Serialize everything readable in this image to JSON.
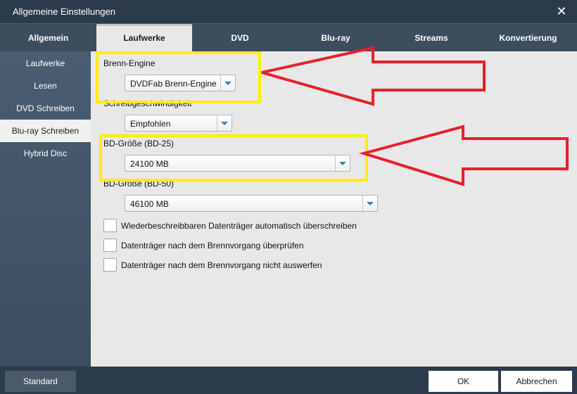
{
  "window": {
    "title": "Allgemeine Einstellungen",
    "close_glyph": "✕"
  },
  "tabs": [
    {
      "label": "Allgemein"
    },
    {
      "label": "Laufwerke"
    },
    {
      "label": "DVD"
    },
    {
      "label": "Blu-ray"
    },
    {
      "label": "Streams"
    },
    {
      "label": "Konvertierung"
    }
  ],
  "active_tab": "Laufwerke",
  "sidebar": {
    "items": [
      {
        "label": "Laufwerke"
      },
      {
        "label": "Lesen"
      },
      {
        "label": "DVD Schreiben"
      },
      {
        "label": "Blu-ray Schreiben"
      },
      {
        "label": "Hybrid Disc"
      }
    ],
    "active": "Blu-ray Schreiben"
  },
  "settings": {
    "engine": {
      "label": "Brenn-Engine",
      "value": "DVDFab Brenn-Engine"
    },
    "speed": {
      "label": "Schreibgeschwindigkeit",
      "value": "Empfohlen"
    },
    "bd25": {
      "label": "BD-Größe (BD-25)",
      "value": "24100 MB"
    },
    "bd50": {
      "label": "BD-Größe (BD-50)",
      "value": "46100 MB"
    },
    "checkboxes": [
      {
        "label": "Wiederbeschreibbaren Datenträger automatisch überschreiben",
        "checked": false
      },
      {
        "label": "Datenträger nach dem Brennvorgang überprüfen",
        "checked": false
      },
      {
        "label": "Datenträger nach dem Brennvorgang nicht auswerfen",
        "checked": false
      }
    ]
  },
  "footer": {
    "standard": "Standard",
    "ok": "OK",
    "cancel": "Abbrechen"
  },
  "colors": {
    "highlight": "#ffee00",
    "annotation_arrow": "#e8202a",
    "dropdown_arrow": "#3a7fb5"
  }
}
